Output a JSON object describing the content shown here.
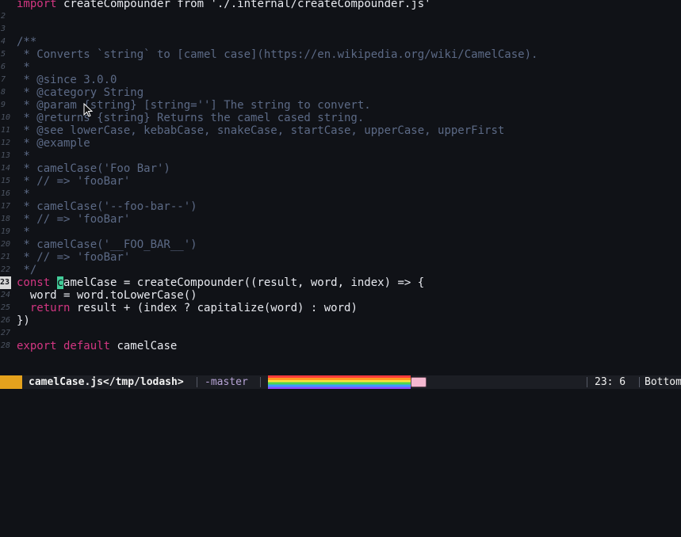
{
  "editor": {
    "lines": [
      {
        "n": "",
        "segs": [
          {
            "c": "kw",
            "t": "import"
          },
          {
            "c": "id",
            "t": " createCompounder from "
          },
          {
            "c": "str",
            "t": "'./.internal/createCompounder.js'"
          }
        ]
      },
      {
        "n": "2",
        "segs": []
      },
      {
        "n": "3",
        "segs": []
      },
      {
        "n": "4",
        "segs": [
          {
            "c": "cm",
            "t": "/**"
          }
        ]
      },
      {
        "n": "5",
        "segs": [
          {
            "c": "cm",
            "t": " * Converts `string` to [camel case](https://en.wikipedia.org/wiki/CamelCase)."
          }
        ]
      },
      {
        "n": "6",
        "segs": [
          {
            "c": "cm",
            "t": " *"
          }
        ]
      },
      {
        "n": "7",
        "segs": [
          {
            "c": "cm",
            "t": " * @since 3.0.0"
          }
        ]
      },
      {
        "n": "8",
        "segs": [
          {
            "c": "cm",
            "t": " * @category String"
          }
        ]
      },
      {
        "n": "9",
        "segs": [
          {
            "c": "cm",
            "t": " * @param {string} [string=''] The string to convert."
          }
        ]
      },
      {
        "n": "10",
        "segs": [
          {
            "c": "cm",
            "t": " * @returns {string} Returns the camel cased string."
          }
        ]
      },
      {
        "n": "11",
        "segs": [
          {
            "c": "cm",
            "t": " * @see lowerCase, kebabCase, snakeCase, startCase, upperCase, upperFirst"
          }
        ]
      },
      {
        "n": "12",
        "segs": [
          {
            "c": "cm",
            "t": " * @example"
          }
        ]
      },
      {
        "n": "13",
        "segs": [
          {
            "c": "cm",
            "t": " *"
          }
        ]
      },
      {
        "n": "14",
        "segs": [
          {
            "c": "cm",
            "t": " * camelCase('Foo Bar')"
          }
        ]
      },
      {
        "n": "15",
        "segs": [
          {
            "c": "cm",
            "t": " * // => 'fooBar'"
          }
        ]
      },
      {
        "n": "16",
        "segs": [
          {
            "c": "cm",
            "t": " *"
          }
        ]
      },
      {
        "n": "17",
        "segs": [
          {
            "c": "cm",
            "t": " * camelCase('--foo-bar--')"
          }
        ]
      },
      {
        "n": "18",
        "segs": [
          {
            "c": "cm",
            "t": " * // => 'fooBar'"
          }
        ]
      },
      {
        "n": "19",
        "segs": [
          {
            "c": "cm",
            "t": " *"
          }
        ]
      },
      {
        "n": "20",
        "segs": [
          {
            "c": "cm",
            "t": " * camelCase('__FOO_BAR__')"
          }
        ]
      },
      {
        "n": "21",
        "segs": [
          {
            "c": "cm",
            "t": " * // => 'fooBar'"
          }
        ]
      },
      {
        "n": "22",
        "segs": [
          {
            "c": "cm",
            "t": " */"
          }
        ]
      },
      {
        "n": "23",
        "cur": true,
        "segs": [
          {
            "c": "kw",
            "t": "const "
          },
          {
            "c": "cursor",
            "t": "c"
          },
          {
            "c": "id",
            "t": "amelCase = createCompounder((result, word, index) => {"
          }
        ]
      },
      {
        "n": "24",
        "segs": [
          {
            "c": "id",
            "t": "  word = word.toLowerCase()"
          }
        ]
      },
      {
        "n": "25",
        "segs": [
          {
            "c": "kw",
            "t": "  return"
          },
          {
            "c": "id",
            "t": " result + (index ? capitalize(word) : word)"
          }
        ]
      },
      {
        "n": "26",
        "segs": [
          {
            "c": "id",
            "t": "})"
          }
        ]
      },
      {
        "n": "27",
        "segs": []
      },
      {
        "n": "28",
        "segs": [
          {
            "c": "kw",
            "t": "export default"
          },
          {
            "c": "id",
            "t": " camelCase"
          }
        ]
      }
    ]
  },
  "status": {
    "mode": "",
    "file": "camelCase.js</tmp/lodash>",
    "branch": "-master",
    "position": "23: 6",
    "scroll": "Bottom"
  },
  "colors": {
    "background": "#101217",
    "comment": "#5c6a86",
    "keyword": "#d33682",
    "text": "#e8eaf0",
    "cursor": "#42cc99",
    "mode": "#e5a21d"
  },
  "icons": [
    "mouse-pointer-icon",
    "nyan-cat-icon"
  ]
}
